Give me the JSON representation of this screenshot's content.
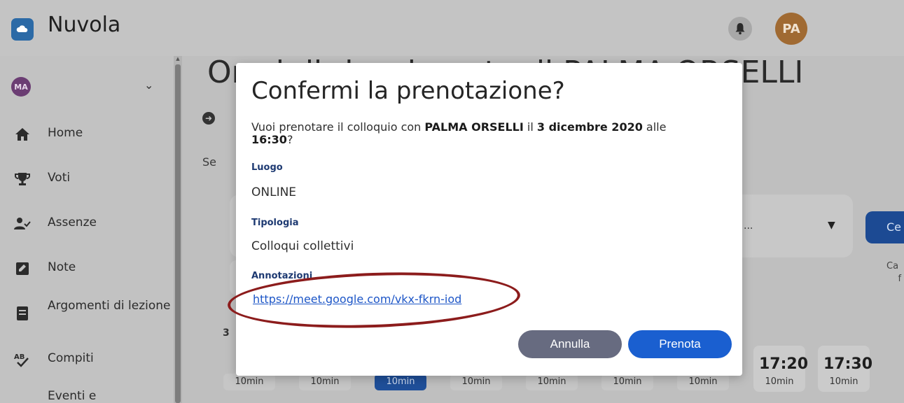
{
  "app": {
    "title": "Nuvola",
    "logo_icon": "cloud-icon",
    "notification_icon": "bell-icon",
    "user_initials": "PA"
  },
  "sidebar": {
    "user": {
      "initials": "MA",
      "chevron_icon": "chevron-down-icon"
    },
    "items": [
      {
        "label": "Home",
        "icon": "home-icon"
      },
      {
        "label": "Voti",
        "icon": "trophy-icon"
      },
      {
        "label": "Assenze",
        "icon": "user-check-icon"
      },
      {
        "label": "Note",
        "icon": "note-icon"
      },
      {
        "label": "Argomenti di lezione",
        "icon": "book-icon"
      },
      {
        "label": "Compiti",
        "icon": "abc-check-icon"
      },
      {
        "label": "Eventi e",
        "icon": "folder-icon"
      }
    ]
  },
  "background": {
    "heading": "Orari di ricevimento di PALMA ORSELLI",
    "se_text": "Se",
    "dots_text": "...",
    "button_text": "Ce",
    "side_text_line1": "Ca",
    "side_text_line2": "f",
    "date_prefix": "3",
    "slots": [
      {
        "time": "",
        "duration": "10min",
        "selected": false
      },
      {
        "time": "",
        "duration": "10min",
        "selected": false
      },
      {
        "time": "",
        "duration": "10min",
        "selected": true
      },
      {
        "time": "",
        "duration": "10min",
        "selected": false
      },
      {
        "time": "",
        "duration": "10min",
        "selected": false
      },
      {
        "time": "",
        "duration": "10min",
        "selected": false
      },
      {
        "time": "",
        "duration": "10min",
        "selected": false
      },
      {
        "time": "17:20",
        "duration": "10min",
        "selected": false
      },
      {
        "time": "17:30",
        "duration": "10min",
        "selected": false
      }
    ]
  },
  "modal": {
    "title": "Confermi la prenotazione?",
    "question_prefix": "Vuoi prenotare il colloquio con ",
    "teacher": "PALMA ORSELLI",
    "question_mid1": " il ",
    "date": "3 dicembre 2020",
    "question_mid2": " alle ",
    "time": "16:30",
    "question_suffix": "?",
    "luogo_label": "Luogo",
    "luogo_value": "ONLINE",
    "tipologia_label": "Tipologia",
    "tipologia_value": "Colloqui collettivi",
    "annotazioni_label": "Annotazioni",
    "annotazioni_link": "https://meet.google.com/vkx-fkrn-iod",
    "cancel_label": "Annulla",
    "confirm_label": "Prenota"
  },
  "colors": {
    "accent": "#1a5fd0",
    "cancel": "#676b80",
    "highlight_ellipse": "#8c1c1c",
    "label": "#1e3a72"
  }
}
